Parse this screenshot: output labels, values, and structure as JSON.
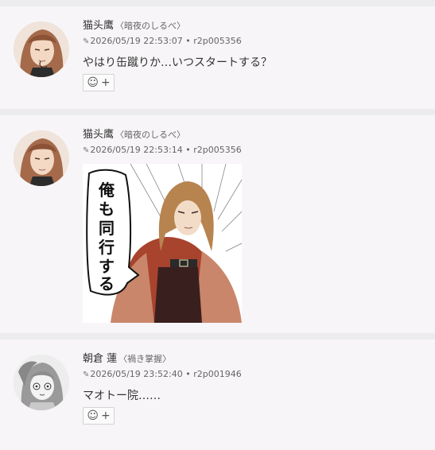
{
  "posts": [
    {
      "author": "猫头鹰",
      "party": "〈暗夜のしるべ〉",
      "timestamp": "2026/05/19 22:53:07",
      "sep": "•",
      "post_id": "r2p005356",
      "message": "やはり缶蹴りか…いつスタートする？",
      "avatar": "brown-haired-man-portrait"
    },
    {
      "author": "猫头鹰",
      "party": "〈暗夜のしるべ〉",
      "timestamp": "2026/05/19 22:53:14",
      "sep": "•",
      "post_id": "r2p005356",
      "avatar": "brown-haired-man-portrait",
      "stamp_text": [
        "俺",
        "も",
        "同",
        "行",
        "す",
        "る"
      ]
    },
    {
      "author": "朝倉 蓮",
      "party": "〈禍き掌握〉",
      "timestamp": "2026/05/19 23:52:40",
      "sep": "•",
      "post_id": "r2p001946",
      "message": "マオトー院……",
      "avatar": "gray-haired-character-portrait"
    }
  ],
  "icons": {
    "pen": "pen-icon",
    "reaction": "smile-icon",
    "add": "plus-icon"
  },
  "colors": {
    "background": "#f7f5f7",
    "divider": "#ececee",
    "muted_text": "#666666"
  }
}
